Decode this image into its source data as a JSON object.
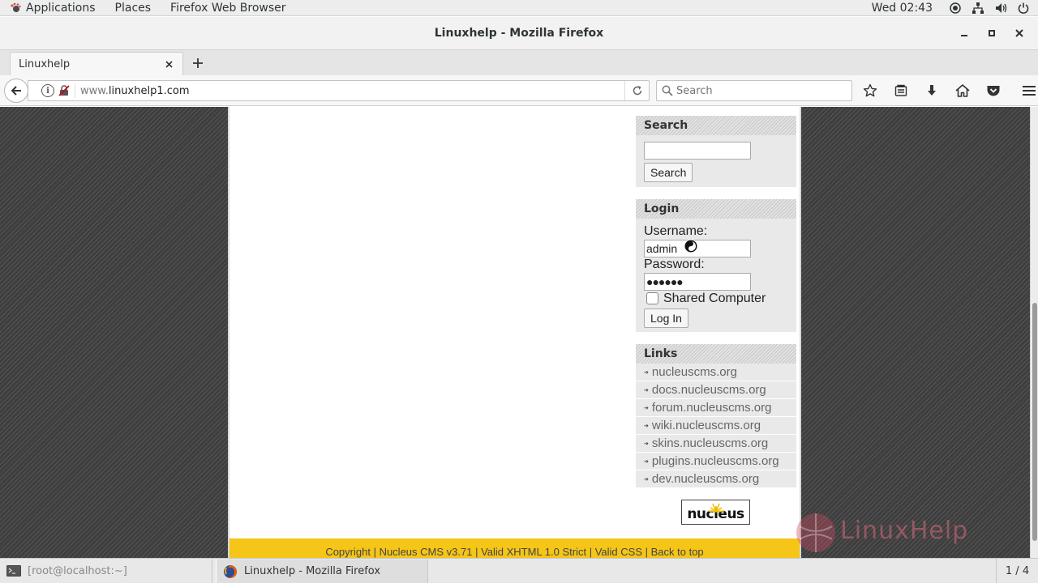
{
  "system": {
    "applications": "Applications",
    "places": "Places",
    "active_app": "Firefox Web Browser",
    "clock": "Wed 02:43"
  },
  "window": {
    "title": "Linuxhelp - Mozilla Firefox"
  },
  "tabs": [
    {
      "label": "Linuxhelp"
    }
  ],
  "navbar": {
    "url_prefix": "www.",
    "url_domain": "linuxhelp1.com",
    "search_placeholder": "Search"
  },
  "sidebar": {
    "search": {
      "heading": "Search",
      "input_value": "",
      "button_label": "Search"
    },
    "login": {
      "heading": "Login",
      "username_label": "Username:",
      "username_value": "admin",
      "password_label": "Password:",
      "password_value": "●●●●●●",
      "shared_label": "Shared Computer",
      "shared_checked": false,
      "button_label": "Log In"
    },
    "links": {
      "heading": "Links",
      "items": [
        "nucleuscms.org",
        "docs.nucleuscms.org",
        "forum.nucleuscms.org",
        "wiki.nucleuscms.org",
        "skins.nucleuscms.org",
        "plugins.nucleuscms.org",
        "dev.nucleuscms.org"
      ]
    },
    "logo_text": "nucleus"
  },
  "footer": {
    "items": [
      "Copyright",
      "Nucleus CMS v3.71",
      "Valid XHTML 1.0 Strict",
      "Valid CSS",
      "Back to top"
    ]
  },
  "watermark": "LinuxHelp",
  "taskbar": {
    "terminal": "[root@localhost:~]",
    "firefox": "Linuxhelp - Mozilla Firefox",
    "workspace": "1 / 4"
  },
  "colors": {
    "footer_bg": "#f5c518",
    "page_bg_pattern": "#4a4a4a",
    "box_bg": "#e9e9e9"
  }
}
